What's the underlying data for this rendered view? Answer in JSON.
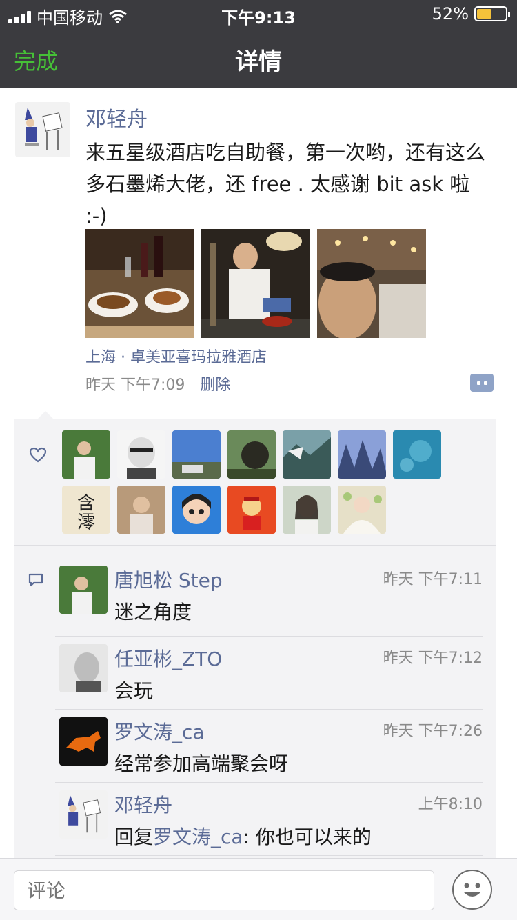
{
  "status_bar": {
    "carrier": "中国移动",
    "time": "下午9:13",
    "battery": "52%",
    "battery_level": 0.52
  },
  "nav": {
    "done": "完成",
    "title": "详情"
  },
  "post": {
    "author": "邓轻舟",
    "text": "来五星级酒店吃自助餐，第一次哟，还有这么多石墨烯大佬，还 free . 太感谢 bit ask 啦  :-)",
    "photos": [
      "dinner-table-photo",
      "chef-photo",
      "selfie-banquet-photo"
    ],
    "location": "上海 · 卓美亚喜玛拉雅酒店",
    "time": "昨天 下午7:09",
    "delete": "删除"
  },
  "likes": {
    "icon": "heart-icon",
    "count": 14
  },
  "comments": [
    {
      "name": "唐旭松 Step",
      "time": "昨天 下午7:11",
      "text": "迷之角度"
    },
    {
      "name": "任亚彬_ZTO",
      "time": "昨天 下午7:12",
      "text": "会玩"
    },
    {
      "name": "罗文涛_ca",
      "time": "昨天 下午7:26",
      "text": "经常参加高端聚会呀"
    },
    {
      "name": "邓轻舟",
      "time": "上午8:10",
      "reply_prefix": "回复",
      "reply_to": "罗文涛_ca",
      "text": ": 你也可以来的"
    }
  ],
  "input": {
    "placeholder": "评论"
  },
  "colors": {
    "link": "#5b6b96",
    "done": "#46c037",
    "header": "#3b3b3f"
  }
}
